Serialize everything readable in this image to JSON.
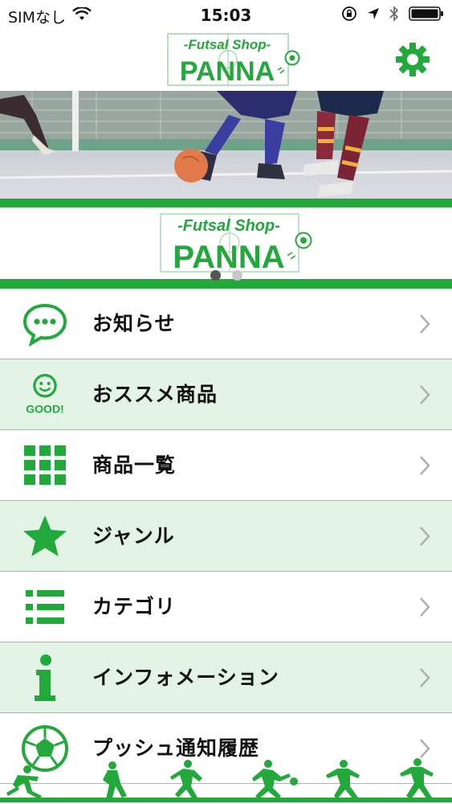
{
  "status_bar": {
    "carrier": "SIMなし",
    "time": "15:03",
    "icons": [
      "wifi-icon",
      "orientation-lock-icon",
      "location-icon",
      "bluetooth-icon",
      "battery-icon"
    ]
  },
  "nav": {
    "logo_text_top": "-Futsal Shop-",
    "logo_text_main": "PANNA",
    "settings_icon": "gear-icon"
  },
  "banner": {
    "logo_text_top": "-Futsal Shop-",
    "logo_text_main": "PANNA",
    "page_count": 2,
    "active_page": 1
  },
  "menu": {
    "items": [
      {
        "label": "お知らせ",
        "icon": "speech-bubble-icon"
      },
      {
        "label": "おススメ商品",
        "icon": "good-smiley-icon",
        "icon_text": "GOOD!"
      },
      {
        "label": "商品一覧",
        "icon": "grid-icon"
      },
      {
        "label": "ジャンル",
        "icon": "star-icon"
      },
      {
        "label": "カテゴリ",
        "icon": "list-icon"
      },
      {
        "label": "インフォメーション",
        "icon": "info-icon"
      },
      {
        "label": "プッシュ通知履歴",
        "icon": "soccer-ball-icon"
      }
    ]
  },
  "colors": {
    "brand_green": "#23a83c",
    "row_alt_bg": "#e3f4e7",
    "chevron": "#b0b0b0"
  }
}
